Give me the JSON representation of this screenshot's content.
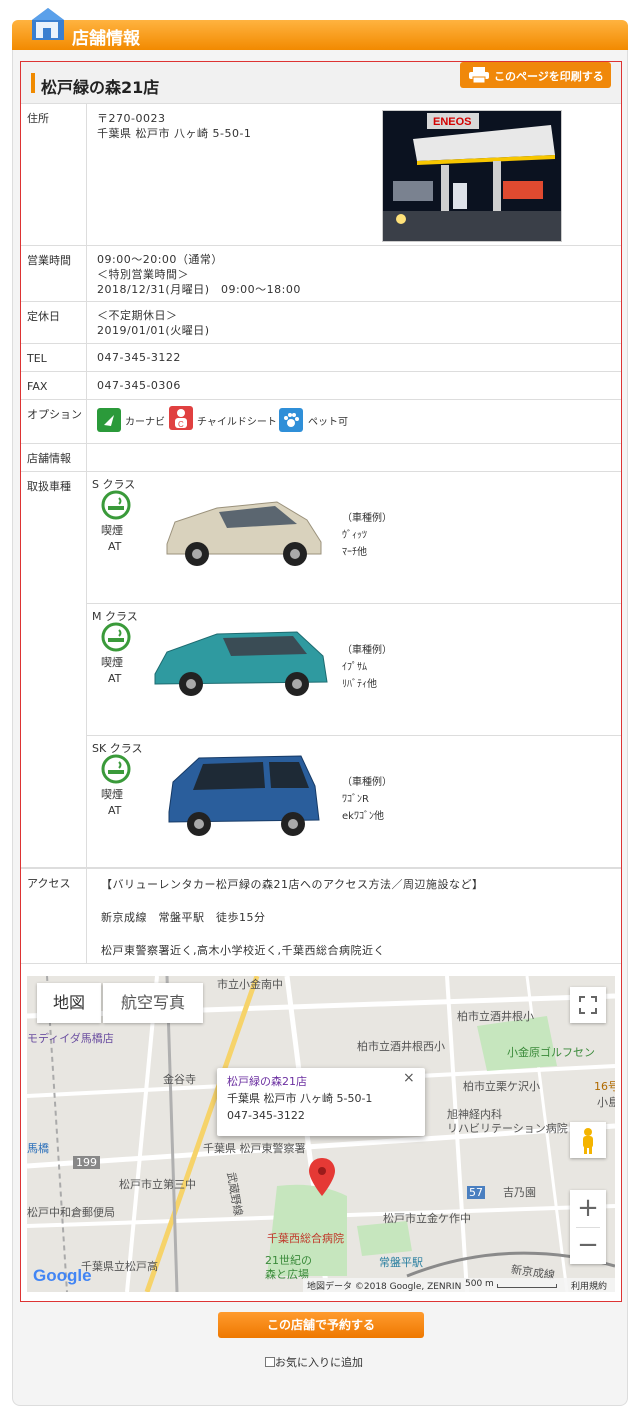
{
  "header": {
    "title": "店舗情報"
  },
  "store": {
    "name": "松戸緑の森21店",
    "print_button": "このページを印刷する",
    "address": {
      "label": "住所",
      "postal": "〒270-0023",
      "line": "千葉県 松戸市 八ヶ崎 5-50-1"
    },
    "hours": {
      "label": "営業時間",
      "lines": [
        "09:00～20:00（通常）",
        "＜特別営業時間＞",
        "2018/12/31(月曜日)　09:00～18:00"
      ]
    },
    "closed": {
      "label": "定休日",
      "lines": [
        "＜不定期休日＞",
        "2019/01/01(火曜日)"
      ]
    },
    "tel": {
      "label": "TEL",
      "value": "047-345-3122"
    },
    "fax": {
      "label": "FAX",
      "value": "047-345-0306"
    },
    "options": {
      "label": "オプション",
      "items": [
        {
          "name": "カーナビ",
          "icon": "car-navigation-icon",
          "color": "#2b9a3a"
        },
        {
          "name": "チャイルドシート",
          "icon": "child-seat-icon",
          "color": "#e04040"
        },
        {
          "name": "ペット可",
          "icon": "pet-paw-icon",
          "color": "#2f8fd8"
        }
      ]
    },
    "info": {
      "label": "店舗情報"
    },
    "vehicles": {
      "label": "取扱車種",
      "classes": [
        {
          "class": "S クラス",
          "smoking": "喫煙",
          "transmission": "AT",
          "example_title": "（車種例）",
          "examples": [
            "ｳﾞｨｯﾂ",
            "ﾏｰﾁ他"
          ],
          "color": "#d9d2bd"
        },
        {
          "class": "M クラス",
          "smoking": "喫煙",
          "transmission": "AT",
          "example_title": "（車種例）",
          "examples": [
            "ｲﾌﾟｻﾑ",
            "ﾘﾊﾞﾃｨ他"
          ],
          "color": "#2f9aa0"
        },
        {
          "class": "SK クラス",
          "smoking": "喫煙",
          "transmission": "AT",
          "example_title": "（車種例）",
          "examples": [
            "ﾜｺﾞﾝR",
            "ekﾜｺﾞﾝ他"
          ],
          "color": "#2a5e9c"
        }
      ]
    },
    "access": {
      "label": "アクセス",
      "lines": [
        "【バリューレンタカー松戸緑の森21店へのアクセス方法／周辺施設など】",
        "新京成線　常盤平駅　徒歩15分",
        "松戸東警察署近く,高木小学校近く,千葉西総合病院近く"
      ]
    }
  },
  "map": {
    "tab_map": "地図",
    "tab_satellite": "航空写真",
    "info_title": "松戸緑の森21店",
    "info_address": "千葉県 松戸市 八ヶ崎 5-50-1",
    "info_tel": "047-345-3122",
    "labels": [
      "市立小金南中",
      "柏市立酒井根小",
      "モディイダ馬橋店",
      "柏市立酒井根西小",
      "小金原ゴルフセン",
      "金谷寺",
      "柏市立栗ケ沢小",
      "旭神経内科",
      "リハビリテーション病院",
      "16号",
      "小島",
      "馬橋",
      "千葉県 松戸東警察署",
      "199",
      "松戸市立第三中",
      "武蔵野線",
      "吉乃園",
      "57",
      "松戸中和倉郵便局",
      "松戸市立金ケ作中",
      "千葉西総合病院",
      "21世紀の",
      "森と広場",
      "常盤平駅",
      "千葉県立松戸高",
      "新京成線"
    ],
    "footer_data": "地図データ ©2018 Google, ZENRIN",
    "footer_scale": "500 m",
    "footer_terms": "利用規約",
    "logo": "Google"
  },
  "actions": {
    "reserve": "この店舗で予約する",
    "favorite": "お気に入りに追加"
  }
}
